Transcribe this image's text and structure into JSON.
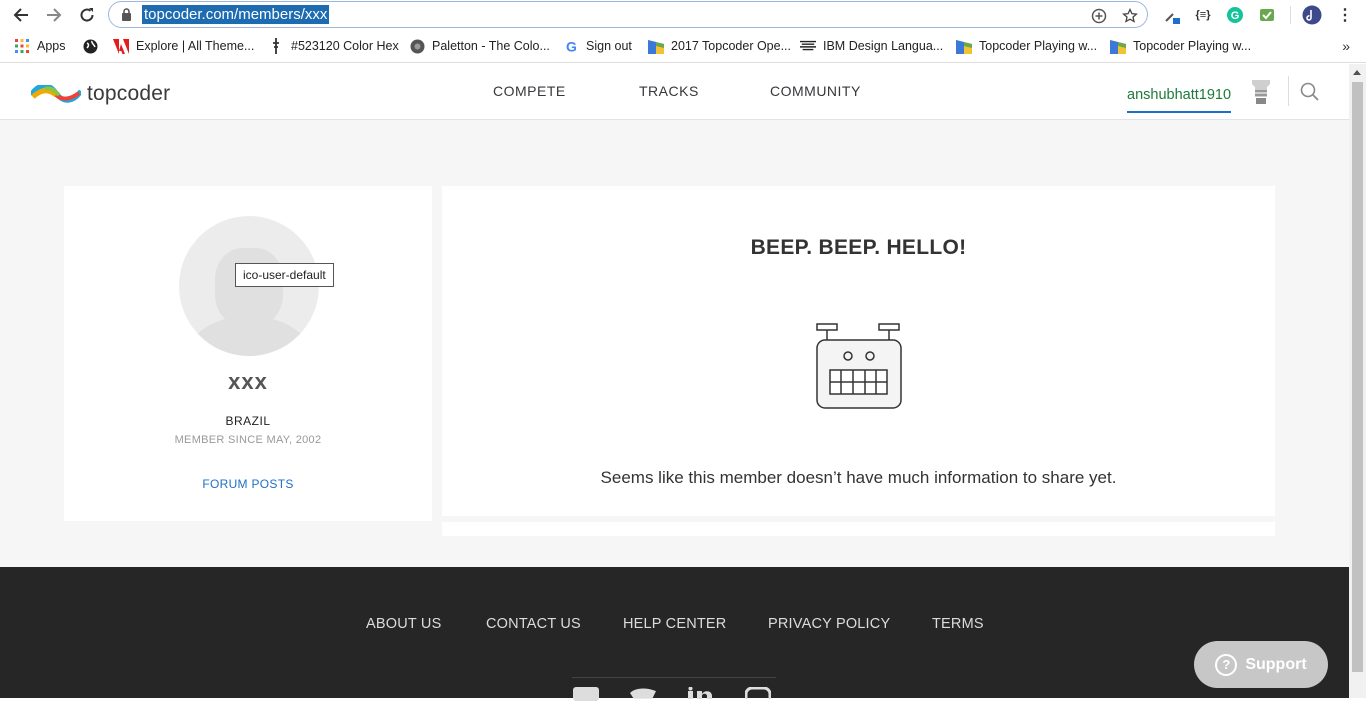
{
  "browser": {
    "url": "topcoder.com/members/xxx",
    "bookmarks": [
      {
        "label": "Apps",
        "icon": "apps-grid-icon"
      },
      {
        "label": "Explore | All Theme...",
        "icon": "adobe-icon"
      },
      {
        "label": "#523120 Color Hex",
        "icon": "pin-icon"
      },
      {
        "label": "Paletton - The Colo...",
        "icon": "paletton-icon"
      },
      {
        "label": "Sign out",
        "icon": "google-icon"
      },
      {
        "label": "2017 Topcoder Ope...",
        "icon": "topcoder-flag-icon"
      },
      {
        "label": "IBM Design Langua...",
        "icon": "ibm-icon"
      },
      {
        "label": "Topcoder Playing w...",
        "icon": "topcoder-flag-icon"
      },
      {
        "label": "Topcoder Playing w...",
        "icon": "topcoder-flag-icon"
      }
    ],
    "more_bookmarks": "»"
  },
  "header": {
    "logo_text": "topcoder",
    "nav": [
      "COMPETE",
      "TRACKS",
      "COMMUNITY"
    ],
    "username": "anshubhatt1910"
  },
  "profile": {
    "avatar_tooltip": "ico-user-default",
    "handle": "xxx",
    "country": "BRAZIL",
    "member_since": "MEMBER SINCE MAY, 2002",
    "forum_posts": "FORUM POSTS"
  },
  "info": {
    "title": "BEEP. BEEP. HELLO!",
    "message": "Seems like this member doesn’t have much information to share yet."
  },
  "footer": {
    "links": [
      "ABOUT US",
      "CONTACT US",
      "HELP CENTER",
      "PRIVACY POLICY",
      "TERMS"
    ]
  },
  "support": {
    "label": "Support"
  },
  "colors": {
    "accent": "#1f6fc8",
    "username": "#1f7a3a",
    "footer_bg": "#262626"
  }
}
